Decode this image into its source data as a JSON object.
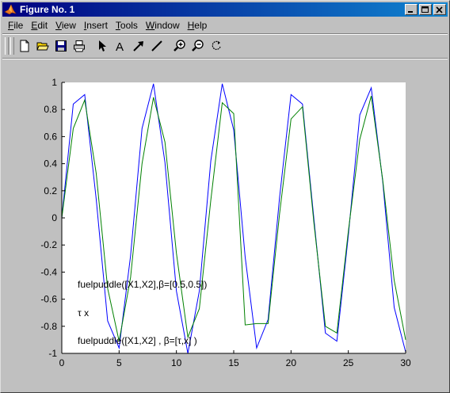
{
  "window": {
    "title": "Figure No. 1"
  },
  "menus": [
    {
      "label": "File",
      "acc": "F",
      "rest": "ile"
    },
    {
      "label": "Edit",
      "acc": "E",
      "rest": "dit"
    },
    {
      "label": "View",
      "acc": "V",
      "rest": "iew"
    },
    {
      "label": "Insert",
      "acc": "I",
      "rest": "nsert"
    },
    {
      "label": "Tools",
      "acc": "T",
      "rest": "ools"
    },
    {
      "label": "Window",
      "acc": "W",
      "rest": "indow"
    },
    {
      "label": "Help",
      "acc": "H",
      "rest": "elp"
    }
  ],
  "toolbar_icons": [
    "new-file-icon",
    "open-folder-icon",
    "save-icon",
    "print-icon",
    "select-arrow-icon",
    "insert-text-icon",
    "insert-arrow-icon",
    "insert-line-icon",
    "zoom-in-icon",
    "zoom-out-icon",
    "rotate-icon"
  ],
  "colors": {
    "series1": "#0000ff",
    "series2": "#008000",
    "plot_background": "#ffffff",
    "figure_background": "#c0c0c0"
  },
  "chart_data": {
    "type": "line",
    "xlim": [
      0,
      30
    ],
    "ylim": [
      -1,
      1
    ],
    "x_ticks": [
      "0",
      "5",
      "10",
      "15",
      "20",
      "25",
      "30"
    ],
    "y_ticks": [
      "1",
      "0.8",
      "0.6",
      "0.4",
      "0.2",
      "0",
      "-0.2",
      "-0.4",
      "-0.6",
      "-0.8",
      "-1"
    ],
    "x": [
      0,
      1,
      2,
      3,
      4,
      5,
      6,
      7,
      8,
      9,
      10,
      11,
      12,
      13,
      14,
      15,
      16,
      17,
      18,
      19,
      20,
      21,
      22,
      23,
      24,
      25,
      26,
      27,
      28,
      29,
      30
    ],
    "series": [
      {
        "values": [
          0.0,
          0.84,
          0.91,
          0.14,
          -0.76,
          -0.96,
          -0.28,
          0.66,
          0.99,
          0.41,
          -0.54,
          -1.0,
          -0.54,
          0.42,
          0.99,
          0.65,
          -0.29,
          -0.96,
          -0.75,
          0.15,
          0.91,
          0.84,
          -0.01,
          -0.85,
          -0.91,
          -0.13,
          0.76,
          0.96,
          0.27,
          -0.66,
          -0.99
        ]
      },
      {
        "values": [
          0.0,
          0.66,
          0.87,
          0.33,
          -0.52,
          -0.91,
          -0.44,
          0.4,
          0.89,
          0.56,
          -0.26,
          -0.88,
          -0.67,
          0.13,
          0.85,
          0.77,
          -0.79,
          -0.78,
          -0.78,
          0.03,
          0.73,
          0.82,
          -0.04,
          -0.8,
          -0.85,
          -0.1,
          0.58,
          0.9,
          0.28,
          -0.46,
          -0.9
        ]
      }
    ],
    "annotations": [
      "fuelpuddle([X1,X2],β=[0.5,0.5])",
      "τ x",
      "fuelpuddle([X1,X2] , β=[τ,x] )"
    ],
    "grid": false
  }
}
